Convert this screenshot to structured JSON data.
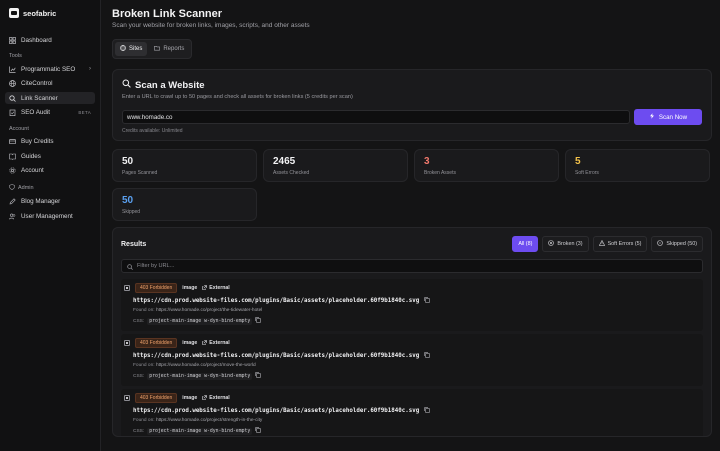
{
  "brand": {
    "name": "seofabric"
  },
  "sidebar": {
    "dashboard": "Dashboard",
    "tools_label": "Tools",
    "tools": [
      {
        "label": "Programmatic SEO",
        "icon": "chart-icon",
        "chevron": "›"
      },
      {
        "label": "CiteControl",
        "icon": "globe-icon"
      },
      {
        "label": "Link Scanner",
        "icon": "search-icon"
      },
      {
        "label": "SEO Audit",
        "icon": "clipboard-icon",
        "badge": "BETA"
      }
    ],
    "account_label": "Account",
    "account": [
      {
        "label": "Buy Credits",
        "icon": "card-icon"
      },
      {
        "label": "Guides",
        "icon": "book-icon"
      },
      {
        "label": "Account",
        "icon": "gear-icon"
      }
    ],
    "admin_label": "Admin",
    "admin": [
      {
        "label": "Blog Manager",
        "icon": "pen-icon"
      },
      {
        "label": "User Management",
        "icon": "users-icon"
      }
    ]
  },
  "header": {
    "title": "Broken Link Scanner",
    "subtitle": "Scan your website for broken links, images, scripts, and other assets"
  },
  "tabs": [
    {
      "label": "Sites"
    },
    {
      "label": "Reports"
    }
  ],
  "scan": {
    "title": "Scan a Website",
    "description": "Enter a URL to crawl up to 50 pages and check all assets for broken links (5 credits per scan)",
    "url_value": "www.homade.co",
    "button": "Scan Now",
    "credits": "Credits available: Unlimited",
    "accent": "#6d4cf0"
  },
  "stats": [
    {
      "value": "50",
      "label": "Pages Scanned",
      "color": "#f2f2f4"
    },
    {
      "value": "2465",
      "label": "Assets Checked",
      "color": "#f2f2f4"
    },
    {
      "value": "3",
      "label": "Broken Assets",
      "color": "#f0786c"
    },
    {
      "value": "5",
      "label": "Soft Errors",
      "color": "#f2c14a"
    },
    {
      "value": "50",
      "label": "Skipped",
      "color": "#5aa0f0"
    }
  ],
  "results": {
    "title": "Results",
    "filters": [
      {
        "label": "All (8)",
        "icon": ""
      },
      {
        "label": "Broken (3)",
        "icon": "x-circle-icon"
      },
      {
        "label": "Soft Errors (5)",
        "icon": "warning-icon"
      },
      {
        "label": "Skipped (50)",
        "icon": "minus-circle-icon"
      }
    ],
    "filter_placeholder": "Filter by URL...",
    "found_label": "Found on:",
    "css_label": "CSS:",
    "items": [
      {
        "status": "403 Forbidden",
        "type": "image",
        "ext": "External",
        "url": "https://cdn.prod.website-files.com/plugins/Basic/assets/placeholder.60f9b1840c.svg",
        "found": "https://www.homade.co/project/the-tidewater-hotel",
        "css": "project-main-image w-dyn-bind-empty"
      },
      {
        "status": "403 Forbidden",
        "type": "image",
        "ext": "External",
        "url": "https://cdn.prod.website-files.com/plugins/Basic/assets/placeholder.60f9b1840c.svg",
        "found": "https://www.homade.co/project/move-the-world",
        "css": "project-main-image w-dyn-bind-empty"
      },
      {
        "status": "403 Forbidden",
        "type": "image",
        "ext": "External",
        "url": "https://cdn.prod.website-files.com/plugins/Basic/assets/placeholder.60f9b1840c.svg",
        "found": "https://www.homade.co/project/strength-in-the-city",
        "css": "project-main-image w-dyn-bind-empty"
      }
    ]
  }
}
